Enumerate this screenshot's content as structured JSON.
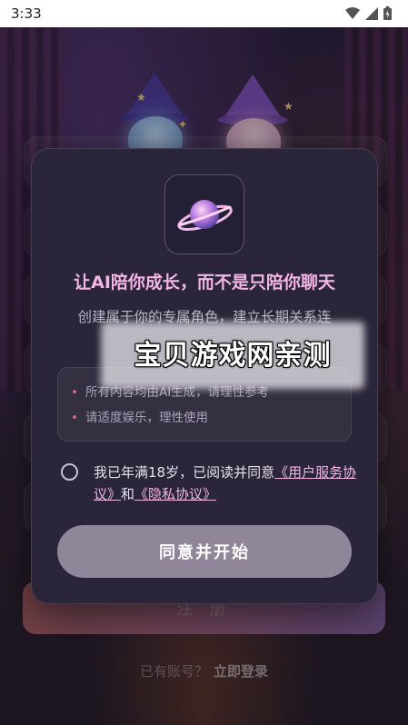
{
  "status_bar": {
    "time": "3:33"
  },
  "background": {
    "register_label": "注 册",
    "login_prompt": "已有账号？",
    "login_link": "立即登录"
  },
  "dialog": {
    "title": "让AI陪你成长，而不是只陪你聊天",
    "subtitle": "创建属于你的专属角色，建立长期关系连",
    "notices": [
      "所有内容均由AI生成，请理性参考",
      "请适度娱乐，理性使用"
    ],
    "agreement": {
      "prefix": "我已年满18岁，已阅读并同意",
      "user_agreement": "《用户服务协议》",
      "and": "和",
      "privacy_policy": "《隐私协议》"
    },
    "agree_button": "同意并开始"
  },
  "watermark": "宝贝游戏网亲测",
  "colors": {
    "accent": "#f2b6e6",
    "button": "#8f8799",
    "dialog_bg": "#2a2538"
  }
}
